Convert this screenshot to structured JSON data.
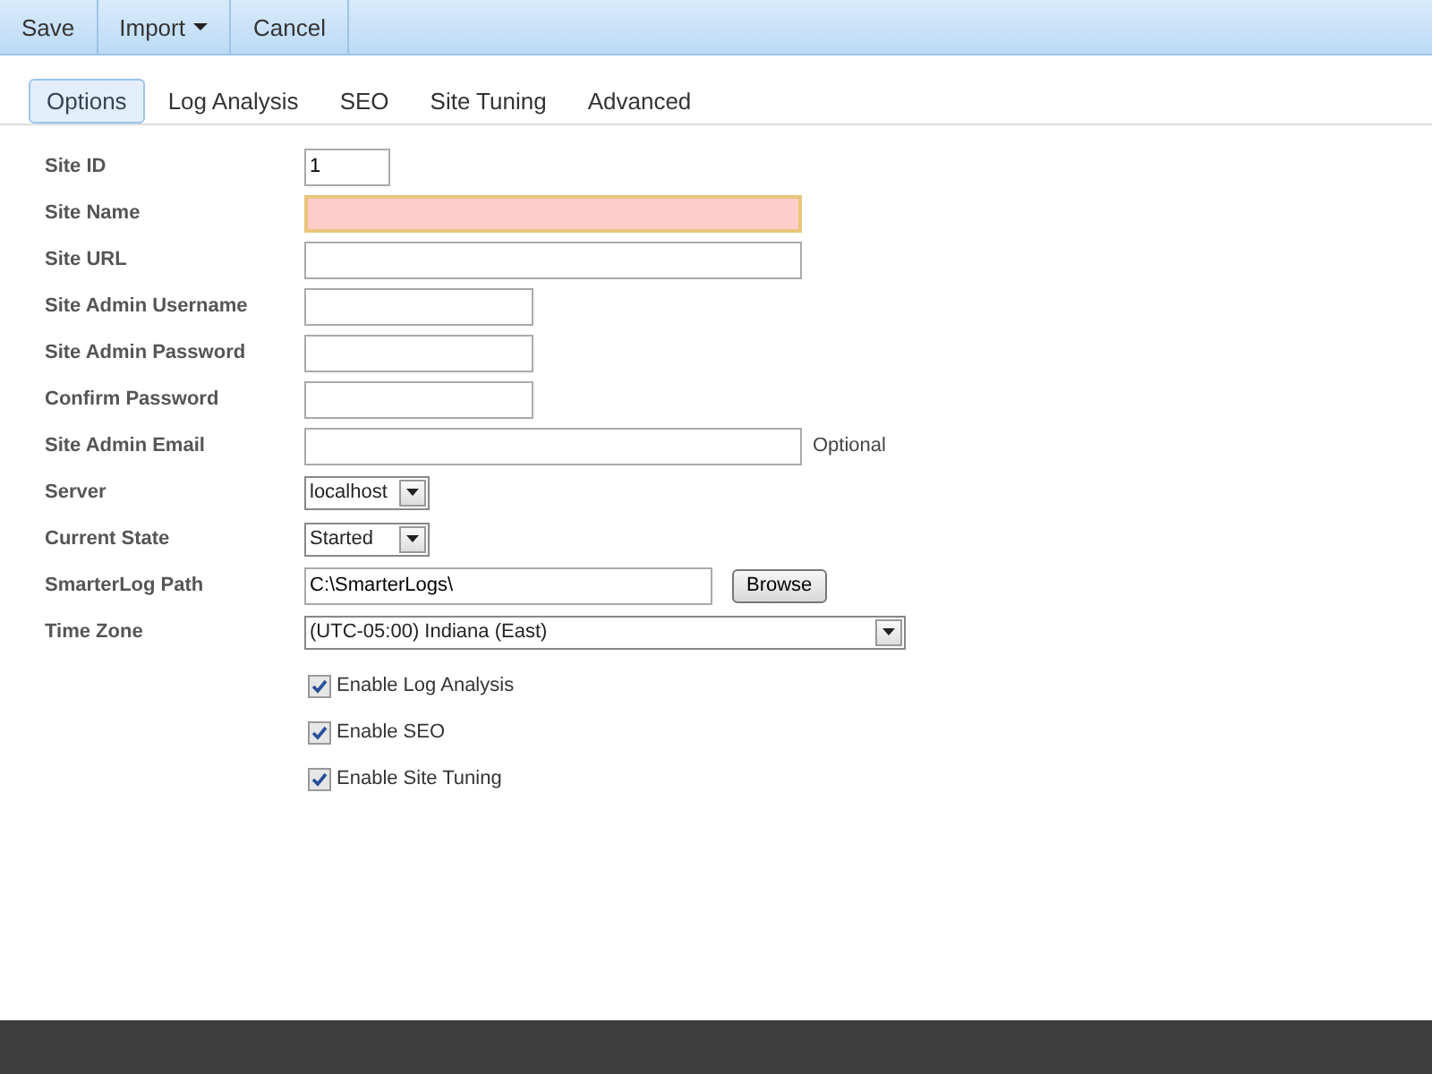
{
  "toolbar": [
    {
      "label": "Save",
      "dropdown": false
    },
    {
      "label": "Import",
      "dropdown": true
    },
    {
      "label": "Cancel",
      "dropdown": false
    }
  ],
  "tabs": [
    {
      "label": "Options",
      "selected": true
    },
    {
      "label": "Log Analysis",
      "selected": false
    },
    {
      "label": "SEO",
      "selected": false
    },
    {
      "label": "Site Tuning",
      "selected": false
    },
    {
      "label": "Advanced",
      "selected": false
    }
  ],
  "fields": [
    {
      "label": "Site ID",
      "kind": "number",
      "value": "1",
      "invalid": false
    },
    {
      "label": "Site Name",
      "kind": "line",
      "invalid": true
    },
    {
      "label": "Site URL",
      "kind": "line",
      "invalid": false
    },
    {
      "label": "Site Admin Username",
      "kind": "short",
      "invalid": false
    },
    {
      "label": "Site Admin Password",
      "kind": "short",
      "invalid": false
    },
    {
      "label": "Confirm Password",
      "kind": "short",
      "invalid": false
    },
    {
      "label": "Site Admin Email",
      "kind": "line",
      "invalid": false,
      "note": "Optional"
    },
    {
      "label": "Server",
      "kind": "picker",
      "value": "localhost"
    },
    {
      "label": "Current State",
      "kind": "picker",
      "value": "Started"
    },
    {
      "label": "SmarterLog Path",
      "kind": "path",
      "value": "C:\\SmarterLogs\\",
      "button": "Browse"
    },
    {
      "label": "Time Zone",
      "kind": "select",
      "value": "(UTC-05:00) Indiana (East)"
    }
  ],
  "options": [
    {
      "label": "Enable Log Analysis",
      "checked": true
    },
    {
      "label": "Enable SEO",
      "checked": true
    },
    {
      "label": "Enable Site Tuning",
      "checked": true
    }
  ]
}
